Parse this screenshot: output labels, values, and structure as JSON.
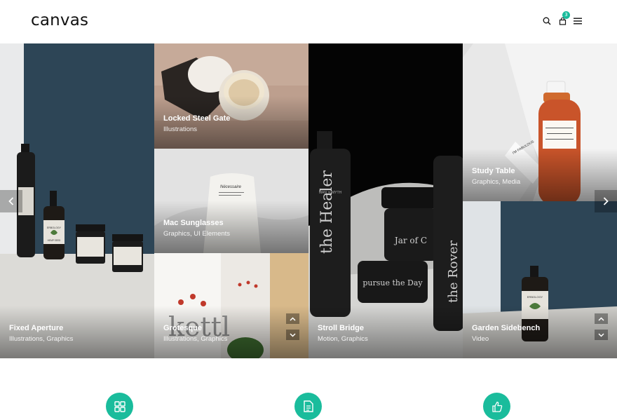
{
  "header": {
    "logo": "canvas",
    "cart_count": "3"
  },
  "gallery": {
    "items": [
      {
        "title": "Fixed Aperture",
        "categories": "Illustrations, Graphics"
      },
      {
        "title": "Locked Steel Gate",
        "categories": "Illustrations"
      },
      {
        "title": "Mac Sunglasses",
        "categories": "Graphics, UI Elements"
      },
      {
        "title": "Grotesque",
        "categories": "Illustrations, Graphics"
      },
      {
        "title": "Stroll Bridge",
        "categories": "Motion, Graphics"
      },
      {
        "title": "Study Table",
        "categories": "Graphics, Media"
      },
      {
        "title": "Garden Sidebench",
        "categories": "Video"
      }
    ],
    "product_text": {
      "hemp_seed": "HEMP SEED",
      "erbology": "ERBOLOGY",
      "healer": "the Healer",
      "man_myth": "MAN ✕ MYTH",
      "pursue": "pursue the Day",
      "jar_of": "Jar of C",
      "rover": "the Rover",
      "necessaire": "Nécessaire",
      "fabulous": "I'M FABULOUS",
      "kettl": "kettl"
    }
  },
  "colors": {
    "accent": "#1abc9c",
    "navy": "#2d4556"
  },
  "icons": [
    "search-icon",
    "cart-icon",
    "menu-icon",
    "chevron-left-icon",
    "chevron-right-icon",
    "chevron-up-icon",
    "chevron-down-icon",
    "grid-icon",
    "document-icon",
    "thumbs-up-icon"
  ]
}
